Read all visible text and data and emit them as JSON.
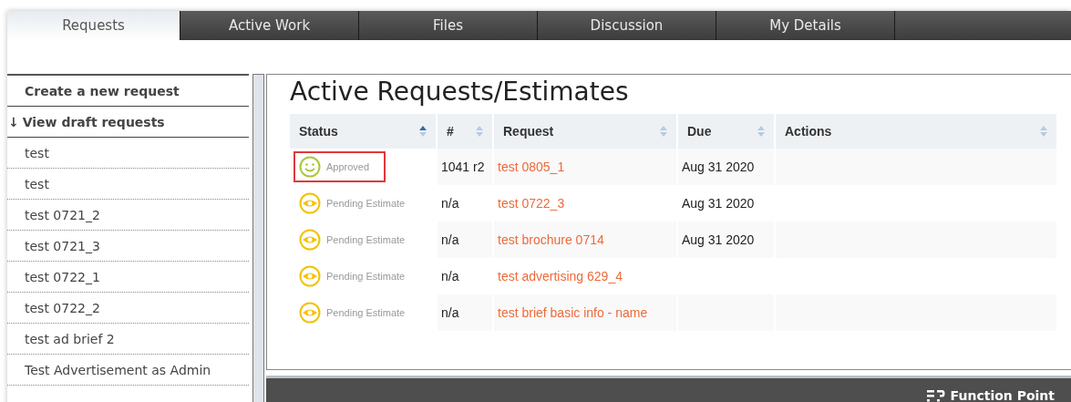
{
  "tabs": [
    {
      "label": "Requests",
      "selected": true
    },
    {
      "label": "Active Work",
      "selected": false
    },
    {
      "label": "Files",
      "selected": false
    },
    {
      "label": "Discussion",
      "selected": false
    },
    {
      "label": "My Details",
      "selected": false
    }
  ],
  "sidebar": {
    "items": [
      {
        "label": "Create a new request",
        "kind": "action"
      },
      {
        "label": "View draft requests",
        "kind": "action",
        "icon": "↓"
      },
      {
        "label": "test",
        "kind": "draft"
      },
      {
        "label": "test",
        "kind": "draft"
      },
      {
        "label": "test 0721_2",
        "kind": "draft"
      },
      {
        "label": "test 0721_3",
        "kind": "draft"
      },
      {
        "label": "test 0722_1",
        "kind": "draft"
      },
      {
        "label": "test 0722_2",
        "kind": "draft"
      },
      {
        "label": "test ad brief 2",
        "kind": "draft"
      },
      {
        "label": "Test Advertisement as Admin",
        "kind": "draft"
      }
    ]
  },
  "main": {
    "title": "Active Requests/Estimates",
    "table": {
      "columns": [
        {
          "label": "Status",
          "sorted": true
        },
        {
          "label": "#",
          "sorted": false
        },
        {
          "label": "Request",
          "sorted": false
        },
        {
          "label": "Due",
          "sorted": false
        },
        {
          "label": "Actions",
          "sorted": false
        }
      ],
      "rows": [
        {
          "status": {
            "kind": "approved",
            "label": "Approved",
            "highlighted": true
          },
          "number": "1041 r2",
          "request": "test 0805_1",
          "due": "Aug 31 2020"
        },
        {
          "status": {
            "kind": "pending",
            "label": "Pending Estimate",
            "highlighted": false
          },
          "number": "n/a",
          "request": "test 0722_3",
          "due": "Aug 31 2020"
        },
        {
          "status": {
            "kind": "pending",
            "label": "Pending Estimate",
            "highlighted": false
          },
          "number": "n/a",
          "request": "test brochure 0714",
          "due": "Aug 31 2020"
        },
        {
          "status": {
            "kind": "pending",
            "label": "Pending Estimate",
            "highlighted": false
          },
          "number": "n/a",
          "request": "test advertising 629_4"
        },
        {
          "status": {
            "kind": "pending",
            "label": "Pending Estimate",
            "highlighted": false
          },
          "number": "n/a",
          "request": "test brief basic info - name"
        }
      ]
    }
  },
  "footer": {
    "brand": "Function Point"
  }
}
